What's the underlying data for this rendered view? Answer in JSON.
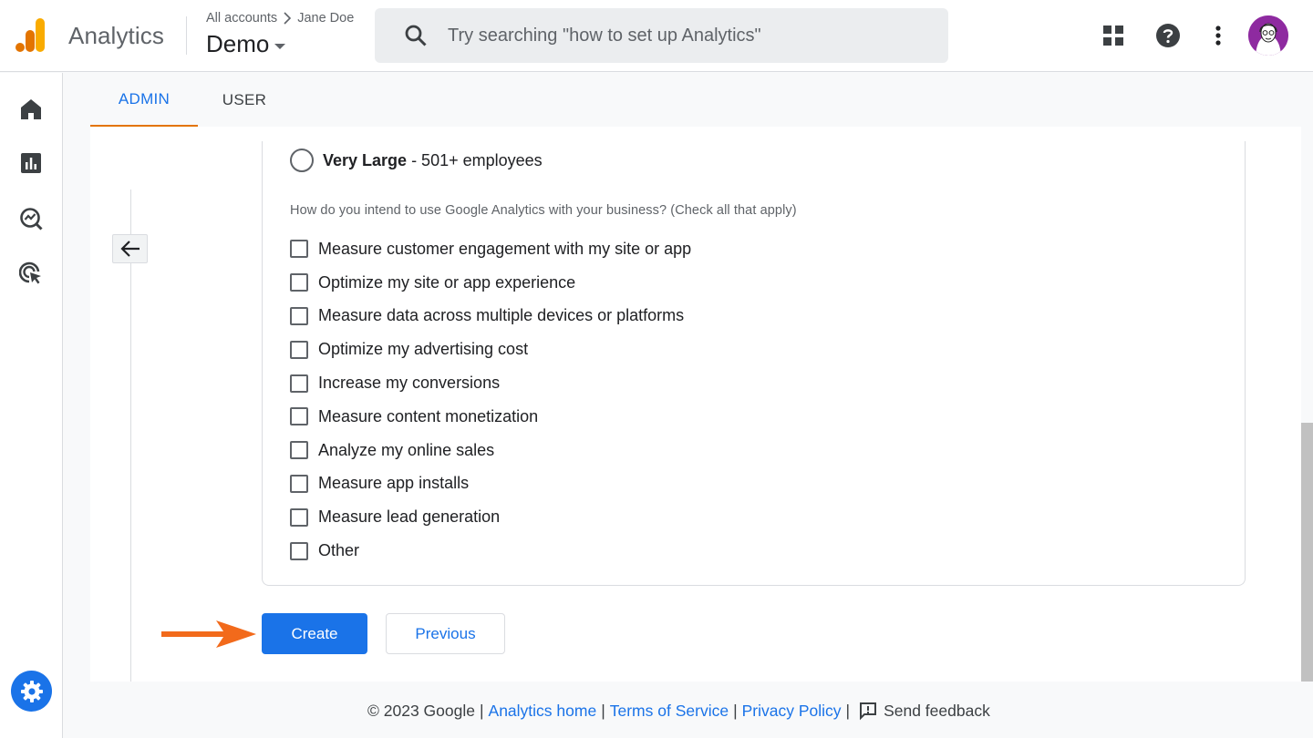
{
  "header": {
    "app_title": "Analytics",
    "breadcrumb_root": "All accounts",
    "breadcrumb_user": "Jane Doe",
    "account_name": "Demo",
    "search_placeholder": "Try searching \"how to set up Analytics\""
  },
  "icons": {
    "logo": "analytics-logo-icon",
    "apps": "apps-grid-icon",
    "help": "help-icon",
    "more": "more-vert-icon",
    "rail": [
      "home-icon",
      "reports-icon",
      "explore-icon",
      "advertising-icon"
    ],
    "settings": "gear-icon",
    "back": "arrow-left-icon",
    "feedback": "feedback-icon"
  },
  "tabs": [
    {
      "label": "ADMIN",
      "active": true
    },
    {
      "label": "USER",
      "active": false
    }
  ],
  "form": {
    "size_option_bold": "Very Large",
    "size_option_rest": " - 501+ employees",
    "question": "How do you intend to use Google Analytics with your business? (Check all that apply)",
    "options": [
      "Measure customer engagement with my site or app",
      "Optimize my site or app experience",
      "Measure data across multiple devices or platforms",
      "Optimize my advertising cost",
      "Increase my conversions",
      "Measure content monetization",
      "Analyze my online sales",
      "Measure app installs",
      "Measure lead generation",
      "Other"
    ],
    "create_label": "Create",
    "previous_label": "Previous"
  },
  "footer": {
    "copyright": "© 2023 Google",
    "links": [
      "Analytics home",
      "Terms of Service",
      "Privacy Policy"
    ],
    "feedback": "Send feedback"
  },
  "colors": {
    "accent": "#1a73e8",
    "tab_underline": "#e37400",
    "annotation_arrow": "#f26a1b",
    "logo_orange": "#f9ab00",
    "logo_dark": "#e37400"
  }
}
